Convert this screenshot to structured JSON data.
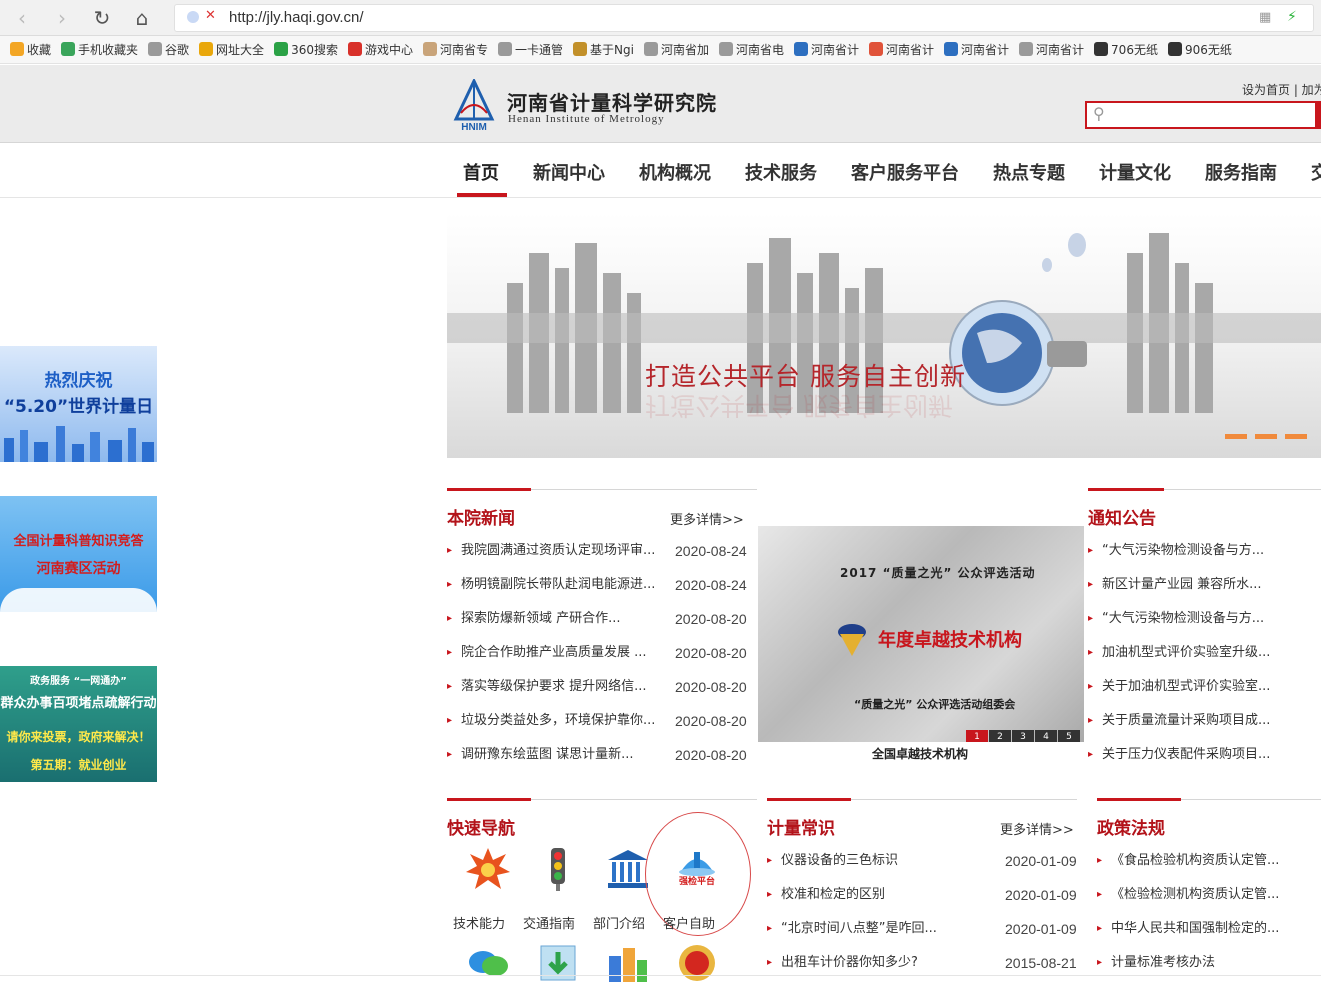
{
  "browser": {
    "url": "http://jly.haqi.gov.cn/",
    "bookmarks": [
      {
        "label": "收藏",
        "color": "#f3a625"
      },
      {
        "label": "手机收藏夹",
        "color": "#3aa55b"
      },
      {
        "label": "谷歌",
        "color": "#9a9a9a"
      },
      {
        "label": "网址大全",
        "color": "#e9a70b"
      },
      {
        "label": "360搜索",
        "color": "#2ba246"
      },
      {
        "label": "游戏中心",
        "color": "#d8312a"
      },
      {
        "label": "河南省专",
        "color": "#c9a47a"
      },
      {
        "label": "一卡通管",
        "color": "#9a9a9a"
      },
      {
        "label": "基于Ngi",
        "color": "#c2902a"
      },
      {
        "label": "河南省加",
        "color": "#9a9a9a"
      },
      {
        "label": "河南省电",
        "color": "#9a9a9a"
      },
      {
        "label": "河南省计",
        "color": "#2d6fc0"
      },
      {
        "label": "河南省计",
        "color": "#e0533a"
      },
      {
        "label": "河南省计",
        "color": "#2d6fc0"
      },
      {
        "label": "河南省计",
        "color": "#9a9a9a"
      },
      {
        "label": "706无纸",
        "color": "#333333"
      },
      {
        "label": "906无纸",
        "color": "#333333"
      }
    ]
  },
  "header": {
    "logo_abbr": "HNIM",
    "title_cn": "河南省计量科学研究院",
    "title_en": "Henan  Institute   of  Metrology",
    "top_links": "设为首页 | 加为",
    "accent": "#c8161d"
  },
  "nav": [
    "首页",
    "新闻中心",
    "机构概况",
    "技术服务",
    "客户服务平台",
    "热点专题",
    "计量文化",
    "服务指南",
    "交"
  ],
  "side_banners": [
    {
      "line1": "热烈庆祝",
      "line2": "“5.20”世界计量日"
    },
    {
      "line1": "全国计量科普知识竞答",
      "line2": "河南赛区活动"
    },
    {
      "line1": "政务服务 “一网通办”",
      "line2": "群众办事百项堵点疏解行动",
      "line3": "请你来投票，政府来解决！",
      "line4": "第五期：就业创业"
    }
  ],
  "hero": {
    "slogan": "打造公共平台   服务自主创新"
  },
  "news": {
    "title": "本院新闻",
    "more": "更多详情>>",
    "items": [
      {
        "title": "我院圆满通过资质认定现场评审...",
        "date": "2020-08-24"
      },
      {
        "title": "杨明镜副院长带队赴润电能源进...",
        "date": "2020-08-24"
      },
      {
        "title": "探索防爆新领域 产研合作...",
        "date": "2020-08-20"
      },
      {
        "title": "院企合作助推产业高质量发展 ...",
        "date": "2020-08-20"
      },
      {
        "title": "落实等级保护要求 提升网络信...",
        "date": "2020-08-20"
      },
      {
        "title": "垃圾分类益处多，环境保护靠你...",
        "date": "2020-08-20"
      },
      {
        "title": "调研豫东绘蓝图 谋思计量新...",
        "date": "2020-08-20"
      }
    ]
  },
  "photo": {
    "line1": "2017 “质量之光” 公众评选活动",
    "line2": "年度卓越技术机构",
    "line3": "“质量之光” 公众评选活动组委会",
    "pages": [
      "1",
      "2",
      "3",
      "4",
      "5"
    ],
    "caption": "全国卓越技术机构"
  },
  "notices": {
    "title": "通知公告",
    "items": [
      "“大气污染物检测设备与方...",
      "新区计量产业园 兼容所水...",
      "“大气污染物检测设备与方...",
      "加油机型式评价实验室升级...",
      "关于加油机型式评价实验室...",
      "关于质量流量计采购项目成...",
      "关于压力仪表配件采购项目..."
    ]
  },
  "quicknav": {
    "title": "快速导航",
    "items": [
      {
        "label": "技术能力",
        "icon": "burst-icon"
      },
      {
        "label": "交通指南",
        "icon": "traffic-light-icon"
      },
      {
        "label": "部门介绍",
        "icon": "building-icon"
      },
      {
        "label": "客户自助",
        "icon": "platform-icon",
        "badge": "强检平台"
      }
    ]
  },
  "knowledge": {
    "title": "计量常识",
    "more": "更多详情>>",
    "items": [
      {
        "title": "仪器设备的三色标识",
        "date": "2020-01-09"
      },
      {
        "title": "校准和检定的区别",
        "date": "2020-01-09"
      },
      {
        "title": "“北京时间八点整”是咋回...",
        "date": "2020-01-09"
      },
      {
        "title": "出租车计价器你知多少?",
        "date": "2015-08-21"
      }
    ]
  },
  "policy": {
    "title": "政策法规",
    "items": [
      "《食品检验机构资质认定管...",
      "《检验检测机构资质认定管...",
      "中华人民共和国强制检定的...",
      "计量标准考核办法"
    ]
  }
}
